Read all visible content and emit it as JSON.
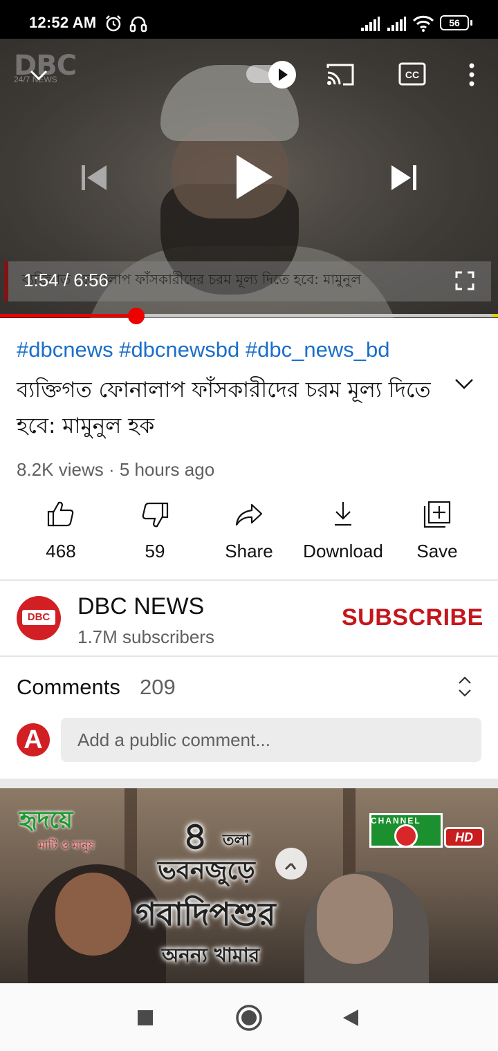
{
  "status_bar": {
    "time": "12:52 AM",
    "battery": "56",
    "icons": [
      "alarm-icon",
      "headphones-icon",
      "signal-icon",
      "signal-icon",
      "wifi-icon",
      "battery-icon"
    ]
  },
  "player": {
    "watermark": "DBC",
    "watermark_sub": "24/7 NEWS",
    "ticker_text": "ব্যক্তিগত ফোনালাপ ফাঁসকারীদের চরম মূল্য দিতে হবে: মামুনুল",
    "current_time": "1:54",
    "duration": "6:56",
    "time_display": "1:54 / 6:56",
    "progress_fraction": 0.274,
    "controls": [
      "minimize-chevron-icon",
      "autoplay-toggle",
      "cast-icon",
      "captions-icon",
      "more-vert-icon",
      "previous-icon",
      "play-icon",
      "next-icon",
      "fullscreen-icon"
    ],
    "progress_color": "#ee0000"
  },
  "video": {
    "hashtags": "#dbcnews #dbcnewsbd #dbc_news_bd",
    "title": "ব্যক্তিগত ফোনালাপ ফাঁসকারীদের চরম মূল্য দিতে হবে: মামুনুল হক",
    "meta": "8.2K views · 5 hours ago"
  },
  "actions": [
    {
      "icon": "thumbs-up-icon",
      "label": "468"
    },
    {
      "icon": "thumbs-down-icon",
      "label": "59"
    },
    {
      "icon": "share-icon",
      "label": "Share"
    },
    {
      "icon": "download-icon",
      "label": "Download"
    },
    {
      "icon": "save-playlist-icon",
      "label": "Save"
    }
  ],
  "channel": {
    "name": "DBC NEWS",
    "subscribers": "1.7M subscribers",
    "subscribe_label": "SUBSCRIBE",
    "avatar_text": "DBC",
    "subscribe_color": "#c4161c"
  },
  "comments": {
    "title": "Comments",
    "count": "209",
    "user_initial": "A",
    "placeholder": "Add a public comment..."
  },
  "next_video": {
    "logo": "হৃদয়ে",
    "logo_sub": "মাটি ও মানুষ",
    "line1_num": "৪",
    "line1_word": "তলা",
    "line2": "ভবনজুড়ে",
    "line3": "গবাদিপশুর",
    "line4": "অনন্য খামার",
    "channel_badge": "CHANNEL",
    "badge_hd": "HD"
  },
  "nav_bar": {
    "icons": [
      "recents-square-icon",
      "home-circle-icon",
      "back-triangle-icon"
    ]
  }
}
